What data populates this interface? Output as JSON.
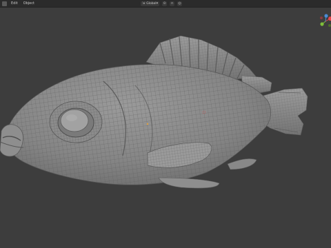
{
  "header": {
    "menu": [
      "Edit",
      "Object"
    ],
    "transform_orientation": "Global",
    "icons": [
      "editor-type-icon",
      "orientation-icon",
      "pivot-icon",
      "snap-icon",
      "proportional-edit-icon"
    ]
  },
  "viewport": {
    "background": "#3d3d3d",
    "mesh_color": "#8a8a8a",
    "wire_color": "#5e5e5e"
  },
  "gizmo": {
    "axes": [
      "X",
      "Y",
      "Z"
    ],
    "colors": {
      "x": "#e8464c",
      "y": "#7fbf3a",
      "z": "#4a8bd6"
    }
  }
}
